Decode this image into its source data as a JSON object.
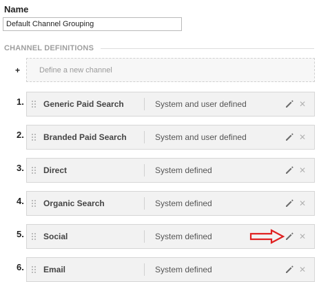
{
  "name_label": "Name",
  "name_value": "Default Channel Grouping",
  "section_title": "CHANNEL DEFINITIONS",
  "new_channel": {
    "plus": "+",
    "label": "Define a new channel"
  },
  "channels": [
    {
      "num": "1.",
      "name": "Generic Paid Search",
      "type": "System and user defined"
    },
    {
      "num": "2.",
      "name": "Branded Paid Search",
      "type": "System and user defined"
    },
    {
      "num": "3.",
      "name": "Direct",
      "type": "System defined"
    },
    {
      "num": "4.",
      "name": "Organic Search",
      "type": "System defined"
    },
    {
      "num": "5.",
      "name": "Social",
      "type": "System defined"
    },
    {
      "num": "6.",
      "name": "Email",
      "type": "System defined"
    }
  ],
  "icons": {
    "edit": "pencil-icon",
    "remove": "close-icon",
    "drag": "drag-handle-icon",
    "annotation": "red-arrow-icon"
  },
  "colors": {
    "annotation_arrow": "#e02020",
    "row_background": "#f2f2f2",
    "section_title": "#9e9e9e"
  }
}
